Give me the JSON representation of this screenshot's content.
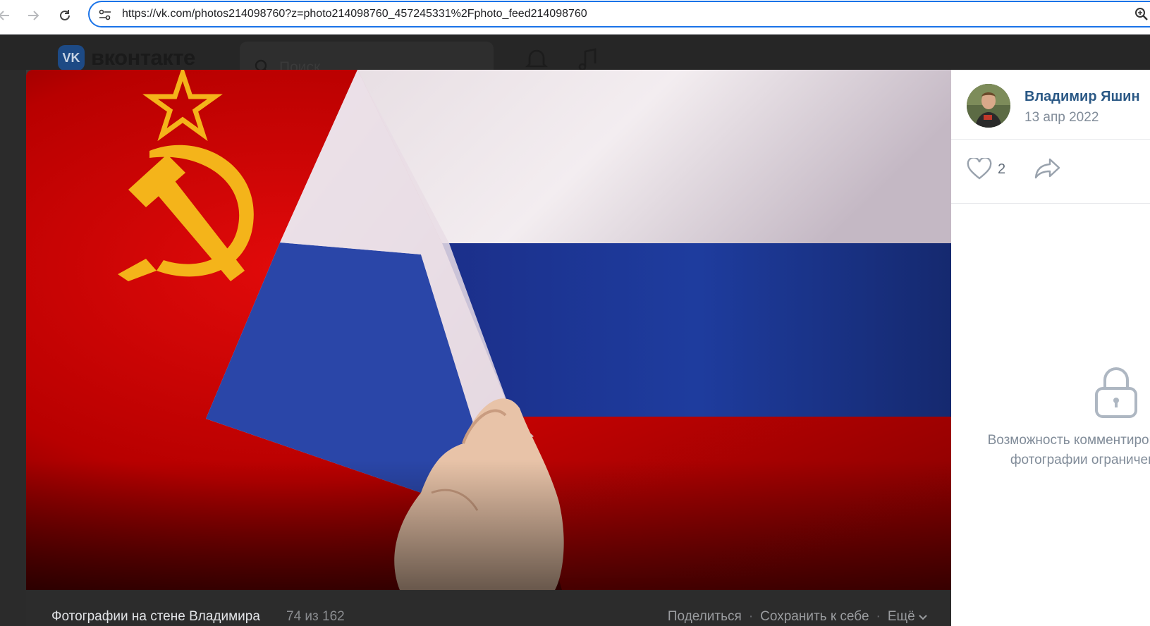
{
  "browser": {
    "url": "https://vk.com/photos214098760?z=photo214098760_457245331%2Fphoto_feed214098760"
  },
  "vk": {
    "logo_text": "вконтакте",
    "logo_mark": "VK",
    "search_placeholder": "Поиск"
  },
  "viewer": {
    "album_title": "Фотографии на стене Владимира",
    "counter": "74 из 162",
    "actions": {
      "share": "Поделиться",
      "save": "Сохранить к себе",
      "more": "Ещё"
    },
    "separator": "·"
  },
  "post": {
    "author": "Владимир Яшин",
    "date": "13 апр 2022",
    "likes": "2",
    "comments_closed_line1": "Возможность комментирования",
    "comments_closed_line2": "фотографии ограничена"
  },
  "colors": {
    "accent": "#1a73e8",
    "vk_link": "#2a5885",
    "flag_red": "#c40000",
    "flag_blue": "#1d3e9e",
    "emblem_gold": "#f4b41a"
  }
}
